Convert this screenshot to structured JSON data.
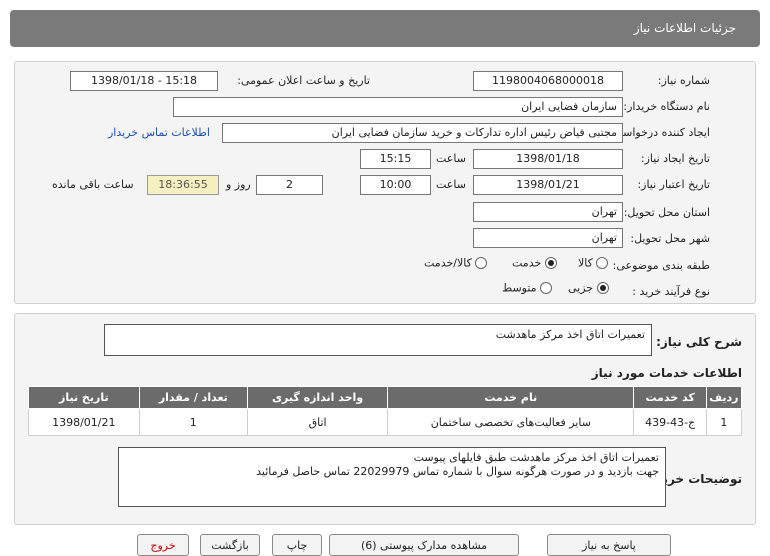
{
  "header": {
    "title": "جزئیات اطلاعات نیاز"
  },
  "fields": {
    "need_number_label": "شماره نیاز:",
    "need_number": "1198004068000018",
    "announce_label": "تاریخ و ساعت اعلان عمومی:",
    "announce_value": "1398/01/18 - 15:18",
    "buyer_org_label": "نام دستگاه خریدار:",
    "buyer_org": "سازمان فضایی ایران",
    "creator_label": "ایجاد کننده درخواست:",
    "creator": "مجتبی  فیاض رئیس اداره تدارکات و خرید سازمان فضایی ایران",
    "contact_link": "اطلاعات تماس خریدار",
    "created_date_label": "تاریخ ایجاد نیاز:",
    "created_date": "1398/01/18",
    "time_label": "ساعت",
    "created_time": "15:15",
    "validity_label": "تاریخ اعتبار نیاز:",
    "validity_date": "1398/01/21",
    "validity_time": "10:00",
    "days_label": "روز و",
    "days_value": "2",
    "remaining_time": "18:36:55",
    "remaining_label": "ساعت باقی مانده",
    "province_label": "استان محل تحویل:",
    "province": "تهران",
    "city_label": "شهر محل تحویل:",
    "city": "تهران",
    "category_label": "طبقه بندی موضوعی:",
    "category_options": [
      "کالا",
      "خدمت",
      "کالا/خدمت"
    ],
    "category_selected": "خدمت",
    "process_label": "نوع فرآیند خرید :",
    "process_options": [
      "جزیی",
      "متوسط"
    ],
    "process_selected": "جزیی"
  },
  "description": {
    "summary_label": "شرح کلی نیاز:",
    "summary": "تعمیرات اتاق اخذ مرکز ماهدشت",
    "services_title": "اطلاعات خدمات مورد نیاز"
  },
  "table": {
    "headers": [
      "ردیف",
      "کد خدمت",
      "نام خدمت",
      "واحد اندازه گیری",
      "تعداد / مقدار",
      "تاریخ نیاز"
    ],
    "rows": [
      [
        "1",
        "ج-43-439",
        "سایر فعالیت‌های تخصصی ساختمان",
        "اتاق",
        "1",
        "1398/01/21"
      ]
    ]
  },
  "buyer_notes": {
    "label": "توضیحات خریدار:",
    "line1": "تعمیرات اتاق اخذ مرکز ماهدشت طبق فایلهای پیوست",
    "line2": "جهت بازدید و در صورت هرگونه سوال با شماره تماس 22029979 تماس  حاصل فرمائید"
  },
  "buttons": {
    "respond": "پاسخ به نیاز",
    "attachments": "مشاهده مدارک پیوستی (6)",
    "print": "چاپ",
    "back": "بازگشت",
    "exit": "خروج"
  }
}
